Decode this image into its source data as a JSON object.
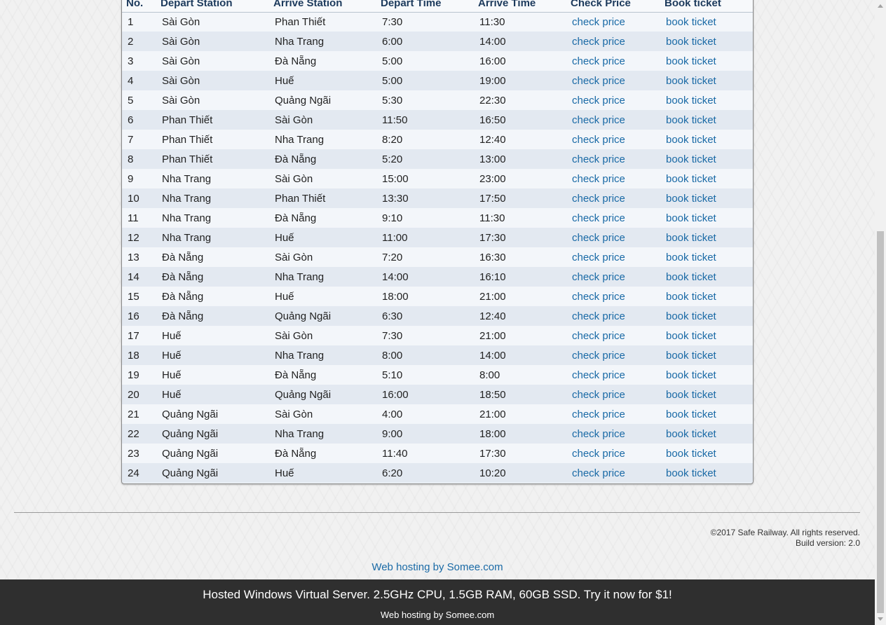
{
  "table": {
    "headers": [
      "No.",
      "Depart Station",
      "Arrive Station",
      "Depart Time",
      "Arrive Time",
      "Check Price",
      "Book ticket"
    ],
    "rows": [
      {
        "no": "1",
        "depart": "Sài Gòn",
        "arrive": "Phan Thiết",
        "dtime": "7:30",
        "atime": "11:30",
        "check": "check price",
        "book": "book ticket"
      },
      {
        "no": "2",
        "depart": "Sài Gòn",
        "arrive": "Nha Trang",
        "dtime": "6:00",
        "atime": "14:00",
        "check": "check price",
        "book": "book ticket"
      },
      {
        "no": "3",
        "depart": "Sài Gòn",
        "arrive": "Đà Nẵng",
        "dtime": "5:00",
        "atime": "16:00",
        "check": "check price",
        "book": "book ticket"
      },
      {
        "no": "4",
        "depart": "Sài Gòn",
        "arrive": "Huế",
        "dtime": "5:00",
        "atime": "19:00",
        "check": "check price",
        "book": "book ticket"
      },
      {
        "no": "5",
        "depart": "Sài Gòn",
        "arrive": "Quảng Ngãi",
        "dtime": "5:30",
        "atime": "22:30",
        "check": "check price",
        "book": "book ticket"
      },
      {
        "no": "6",
        "depart": "Phan Thiết",
        "arrive": "Sài Gòn",
        "dtime": "11:50",
        "atime": "16:50",
        "check": "check price",
        "book": "book ticket"
      },
      {
        "no": "7",
        "depart": "Phan Thiết",
        "arrive": "Nha Trang",
        "dtime": "8:20",
        "atime": "12:40",
        "check": "check price",
        "book": "book ticket"
      },
      {
        "no": "8",
        "depart": "Phan Thiết",
        "arrive": "Đà Nẵng",
        "dtime": "5:20",
        "atime": "13:00",
        "check": "check price",
        "book": "book ticket"
      },
      {
        "no": "9",
        "depart": "Nha Trang",
        "arrive": "Sài Gòn",
        "dtime": "15:00",
        "atime": "23:00",
        "check": "check price",
        "book": "book ticket"
      },
      {
        "no": "10",
        "depart": "Nha Trang",
        "arrive": "Phan Thiết",
        "dtime": "13:30",
        "atime": "17:50",
        "check": "check price",
        "book": "book ticket"
      },
      {
        "no": "11",
        "depart": "Nha Trang",
        "arrive": "Đà Nẵng",
        "dtime": "9:10",
        "atime": "11:30",
        "check": "check price",
        "book": "book ticket"
      },
      {
        "no": "12",
        "depart": "Nha Trang",
        "arrive": "Huế",
        "dtime": "11:00",
        "atime": "17:30",
        "check": "check price",
        "book": "book ticket"
      },
      {
        "no": "13",
        "depart": "Đà Nẵng",
        "arrive": "Sài Gòn",
        "dtime": "7:20",
        "atime": "16:30",
        "check": "check price",
        "book": "book ticket"
      },
      {
        "no": "14",
        "depart": "Đà Nẵng",
        "arrive": "Nha Trang",
        "dtime": "14:00",
        "atime": "16:10",
        "check": "check price",
        "book": "book ticket"
      },
      {
        "no": "15",
        "depart": "Đà Nẵng",
        "arrive": "Huế",
        "dtime": "18:00",
        "atime": "21:00",
        "check": "check price",
        "book": "book ticket"
      },
      {
        "no": "16",
        "depart": "Đà Nẵng",
        "arrive": "Quảng Ngãi",
        "dtime": "6:30",
        "atime": "12:40",
        "check": "check price",
        "book": "book ticket"
      },
      {
        "no": "17",
        "depart": "Huế",
        "arrive": "Sài Gòn",
        "dtime": "7:30",
        "atime": "21:00",
        "check": "check price",
        "book": "book ticket"
      },
      {
        "no": "18",
        "depart": "Huế",
        "arrive": "Nha Trang",
        "dtime": "8:00",
        "atime": "14:00",
        "check": "check price",
        "book": "book ticket"
      },
      {
        "no": "19",
        "depart": "Huế",
        "arrive": "Đà Nẵng",
        "dtime": "5:10",
        "atime": "8:00",
        "check": "check price",
        "book": "book ticket"
      },
      {
        "no": "20",
        "depart": "Huế",
        "arrive": "Quảng Ngãi",
        "dtime": "16:00",
        "atime": "18:50",
        "check": "check price",
        "book": "book ticket"
      },
      {
        "no": "21",
        "depart": "Quảng Ngãi",
        "arrive": "Sài Gòn",
        "dtime": "4:00",
        "atime": "21:00",
        "check": "check price",
        "book": "book ticket"
      },
      {
        "no": "22",
        "depart": "Quảng Ngãi",
        "arrive": "Nha Trang",
        "dtime": "9:00",
        "atime": "18:00",
        "check": "check price",
        "book": "book ticket"
      },
      {
        "no": "23",
        "depart": "Quảng Ngãi",
        "arrive": "Đà Nẵng",
        "dtime": "11:40",
        "atime": "17:30",
        "check": "check price",
        "book": "book ticket"
      },
      {
        "no": "24",
        "depart": "Quảng Ngãi",
        "arrive": "Huế",
        "dtime": "6:20",
        "atime": "10:20",
        "check": "check price",
        "book": "book ticket"
      }
    ]
  },
  "footer": {
    "copyright": "©2017 Safe Railway. All rights reserved.",
    "build": "Build version: 2.0",
    "hosting_link": "Web hosting by Somee.com"
  },
  "ad_bar": {
    "message": "Hosted Windows Virtual Server. 2.5GHz CPU, 1.5GB RAM, 60GB SSD. Try it now for $1!",
    "link": "Web hosting by Somee.com"
  },
  "colors": {
    "link": "#1a6aa6",
    "header_text": "#1c3a5c",
    "ad_bar_bg": "#2f2f2f"
  }
}
